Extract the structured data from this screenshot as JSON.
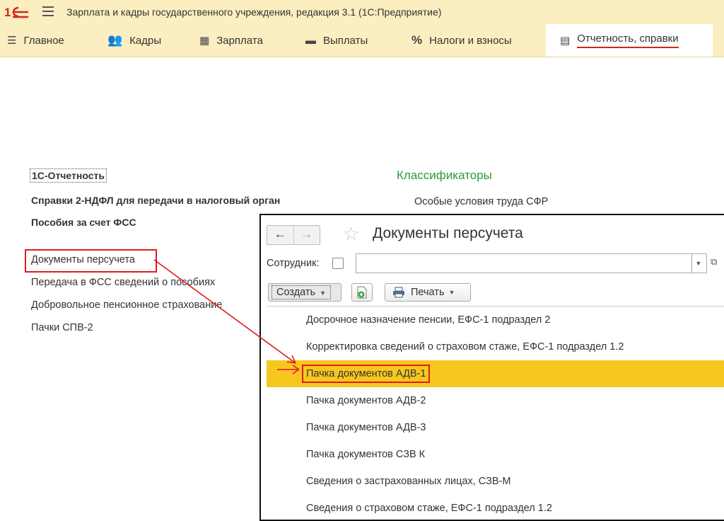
{
  "app": {
    "title": "Зарплата и кадры государственного учреждения, редакция 3.1  (1С:Предприятие)"
  },
  "sections": [
    {
      "label": "Главное",
      "icon": "menu-icon"
    },
    {
      "label": "Кадры",
      "icon": "people-icon"
    },
    {
      "label": "Зарплата",
      "icon": "calculator-icon"
    },
    {
      "label": "Выплаты",
      "icon": "wallet-icon"
    },
    {
      "label": "Налоги и взносы",
      "icon": "percent-icon"
    },
    {
      "label": "Отчетность, справки",
      "icon": "document-icon"
    }
  ],
  "left_panel": {
    "bold_links": [
      "1С-Отчетность",
      "Справки 2-НДФЛ для передачи в налоговый орган",
      "Пособия за счет ФСС"
    ],
    "links": [
      "Документы персучета",
      "Передача в ФСС сведений о пособиях",
      "Добровольное пенсионное страхование",
      "Пачки СПВ-2"
    ]
  },
  "right_panel": {
    "group_title": "Классификаторы",
    "links": [
      "Особые условия труда СФР"
    ]
  },
  "popup": {
    "title": "Документы персучета",
    "employee_label": "Сотрудник:",
    "employee_value": "",
    "create_label": "Создать",
    "print_label": "Печать",
    "menu_items": [
      "Досрочное назначение пенсии, ЕФС-1 подраздел 2",
      "Корректировка сведений о страховом стаже, ЕФС-1 подраздел 1.2",
      "Пачка документов АДВ-1",
      "Пачка документов АДВ-2",
      "Пачка документов АДВ-3",
      "Пачка документов СЗВ К",
      "Сведения о застрахованных лицах, СЗВ-М",
      "Сведения о страховом стаже, ЕФС-1 подраздел 1.2"
    ],
    "highlighted_index": 2
  },
  "colors": {
    "header_bg": "#fbeec0",
    "highlight": "#f7c71f",
    "annotation_red": "#e21b1b",
    "group_title_green": "#2a9a37"
  }
}
